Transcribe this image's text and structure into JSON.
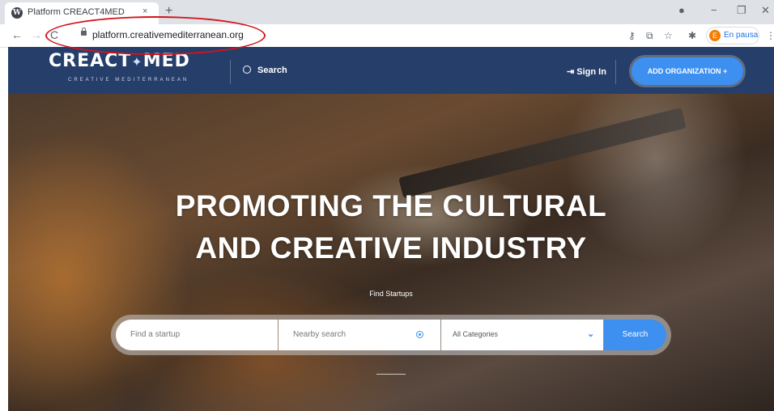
{
  "browser": {
    "tab_title": "Platform CREACT4MED",
    "tab_close": "×",
    "new_tab": "+",
    "url": "platform.creativemediterranean.org",
    "profile_initial": "E",
    "profile_label": "En pausa",
    "back_icon": "←",
    "forward_icon": "→",
    "reload_icon": "C",
    "minimize": "−",
    "restore": "❐",
    "close": "✕"
  },
  "site": {
    "logo_text": "CREACT",
    "logo_text2": "MED",
    "logo_star": "✦",
    "logo_subtitle": "CREATIVE MEDITERRANEAN",
    "search_label": "Search",
    "signin_label": "Sign In",
    "signin_icon": "⇥",
    "add_org_label": "ADD ORGANIZATION +"
  },
  "hero": {
    "headline_line1": "PROMOTING THE CULTURAL",
    "headline_line2": "AND CREATIVE INDUSTRY",
    "find_label": "Find Startups",
    "search_placeholder": "Find a startup",
    "nearby_placeholder": "Nearby search",
    "category_label": "All Categories",
    "search_button": "Search"
  },
  "colors": {
    "header_bg": "#263f6a",
    "accent": "#3d8ff0",
    "annotation": "#d3141c"
  }
}
